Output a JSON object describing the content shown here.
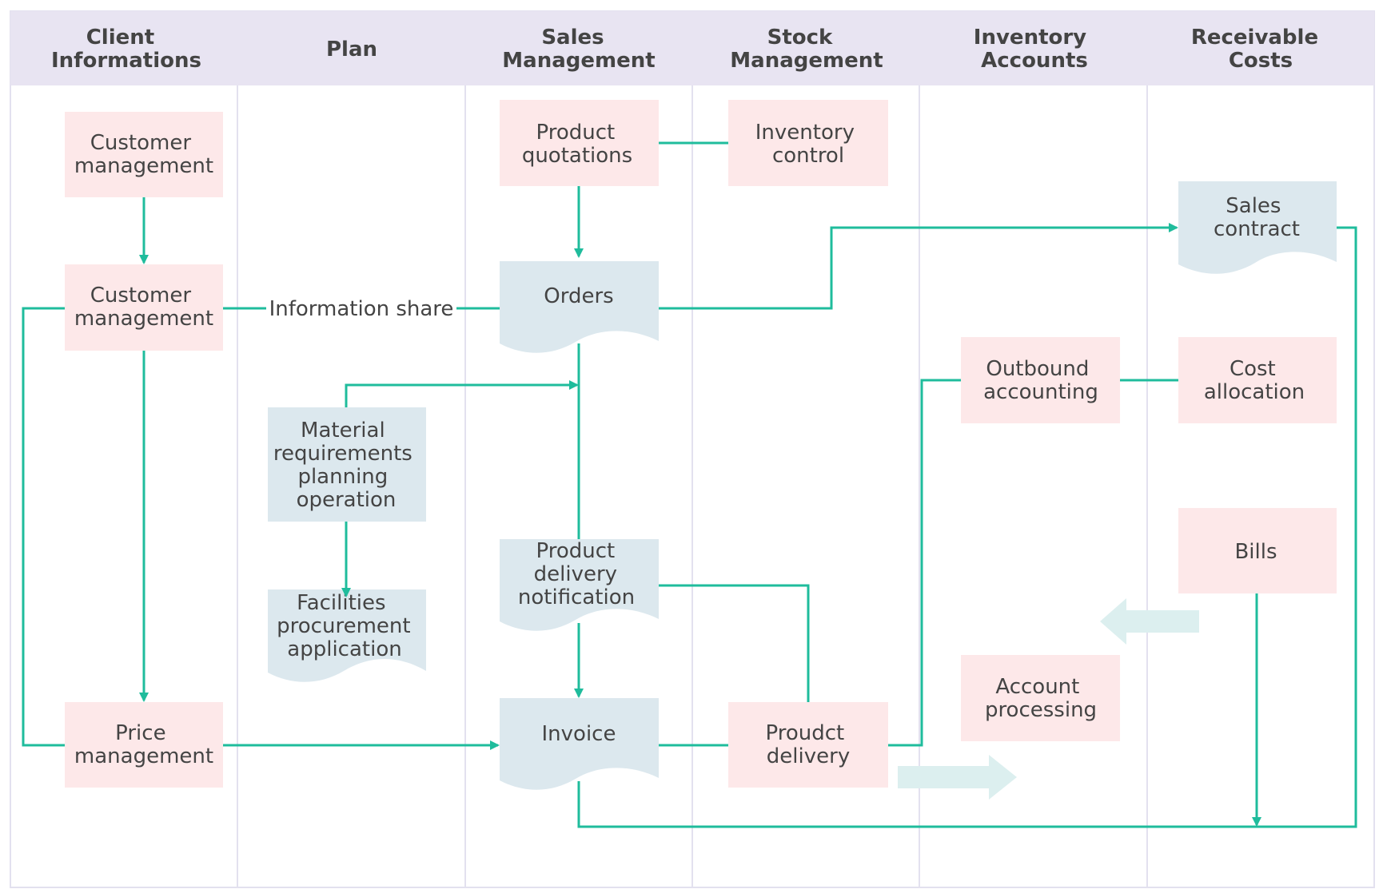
{
  "diagram": {
    "type": "swimlane-flowchart",
    "colors": {
      "header_bg": "#e8e4f2",
      "lane_border": "#e3e1ef",
      "process_fill": "#fde8e9",
      "document_fill": "#dce8ee",
      "connector": "#1fbc9c",
      "block_arrow": "#dcefef",
      "text": "#444444"
    },
    "lanes": [
      {
        "id": "client",
        "title": [
          "Client",
          "Informations"
        ]
      },
      {
        "id": "plan",
        "title": [
          "Plan"
        ]
      },
      {
        "id": "sales",
        "title": [
          "Sales",
          "Management"
        ]
      },
      {
        "id": "stock",
        "title": [
          "Stock",
          "Management"
        ]
      },
      {
        "id": "inventory",
        "title": [
          "Inventory",
          "Accounts"
        ]
      },
      {
        "id": "receivable",
        "title": [
          "Receivable",
          "Costs"
        ]
      }
    ],
    "nodes": [
      {
        "id": "customer-management-1",
        "lane": "client",
        "shape": "process",
        "lines": [
          "Customer",
          "management"
        ]
      },
      {
        "id": "customer-management-2",
        "lane": "client",
        "shape": "process",
        "lines": [
          "Customer",
          "management"
        ]
      },
      {
        "id": "price-management",
        "lane": "client",
        "shape": "process",
        "lines": [
          "Price",
          "management"
        ]
      },
      {
        "id": "mrp-operation",
        "lane": "plan",
        "shape": "process-blue",
        "lines": [
          "Material",
          "requirements",
          "planning",
          "operation"
        ]
      },
      {
        "id": "facilities-procurement",
        "lane": "plan",
        "shape": "document",
        "lines": [
          "Facilities",
          "procurement",
          "application"
        ]
      },
      {
        "id": "product-quotations",
        "lane": "sales",
        "shape": "process",
        "lines": [
          "Product",
          "quotations"
        ]
      },
      {
        "id": "orders",
        "lane": "sales",
        "shape": "document",
        "lines": [
          "Orders"
        ]
      },
      {
        "id": "product-delivery-notification",
        "lane": "sales",
        "shape": "document",
        "lines": [
          "Product",
          "delivery",
          "notification"
        ]
      },
      {
        "id": "invoice",
        "lane": "sales",
        "shape": "document",
        "lines": [
          "Invoice"
        ]
      },
      {
        "id": "inventory-control",
        "lane": "stock",
        "shape": "process",
        "lines": [
          "Inventory",
          "control"
        ]
      },
      {
        "id": "proudct-delivery",
        "lane": "stock",
        "shape": "process",
        "lines": [
          "Proudct",
          "delivery"
        ]
      },
      {
        "id": "outbound-accounting",
        "lane": "inventory",
        "shape": "process",
        "lines": [
          "Outbound",
          "accounting"
        ]
      },
      {
        "id": "account-processing",
        "lane": "inventory",
        "shape": "process",
        "lines": [
          "Account",
          "processing"
        ]
      },
      {
        "id": "sales-contract",
        "lane": "receivable",
        "shape": "document",
        "lines": [
          "Sales",
          "contract"
        ]
      },
      {
        "id": "cost-allocation",
        "lane": "receivable",
        "shape": "process",
        "lines": [
          "Cost",
          "allocation"
        ]
      },
      {
        "id": "bills",
        "lane": "receivable",
        "shape": "process",
        "lines": [
          "Bills"
        ]
      }
    ],
    "edges": [
      {
        "from": "customer-management-1",
        "to": "customer-management-2",
        "arrow": true
      },
      {
        "from": "customer-management-2",
        "to": "orders",
        "arrow": false,
        "label": "Information share"
      },
      {
        "from": "customer-management-2",
        "to": "price-management",
        "arrow": true
      },
      {
        "from": "customer-management-2",
        "to": "price-management",
        "arrow": false,
        "route": "left-loop"
      },
      {
        "from": "price-management",
        "to": "invoice",
        "arrow": true
      },
      {
        "from": "product-quotations",
        "to": "inventory-control",
        "arrow": false
      },
      {
        "from": "product-quotations",
        "to": "orders",
        "arrow": true
      },
      {
        "from": "orders",
        "to": "sales-contract",
        "arrow": true
      },
      {
        "from": "orders",
        "to": "product-delivery-notification",
        "arrow": false
      },
      {
        "from": "mrp-operation",
        "to": "orders",
        "arrow": true
      },
      {
        "from": "mrp-operation",
        "to": "facilities-procurement",
        "arrow": true
      },
      {
        "from": "product-delivery-notification",
        "to": "invoice",
        "arrow": true
      },
      {
        "from": "product-delivery-notification",
        "to": "proudct-delivery",
        "arrow": false
      },
      {
        "from": "invoice",
        "to": "proudct-delivery",
        "arrow": false
      },
      {
        "from": "proudct-delivery",
        "to": "outbound-accounting",
        "arrow": false
      },
      {
        "from": "outbound-accounting",
        "to": "cost-allocation",
        "arrow": false
      },
      {
        "from": "sales-contract",
        "to": "bottom-loop",
        "arrow": false
      },
      {
        "from": "invoice",
        "to": "bottom-loop",
        "arrow": false
      },
      {
        "from": "bills",
        "to": "bottom-loop",
        "arrow": true
      }
    ],
    "block_arrows": [
      {
        "id": "block-arrow-left",
        "direction": "left"
      },
      {
        "id": "block-arrow-right",
        "direction": "right"
      }
    ]
  }
}
